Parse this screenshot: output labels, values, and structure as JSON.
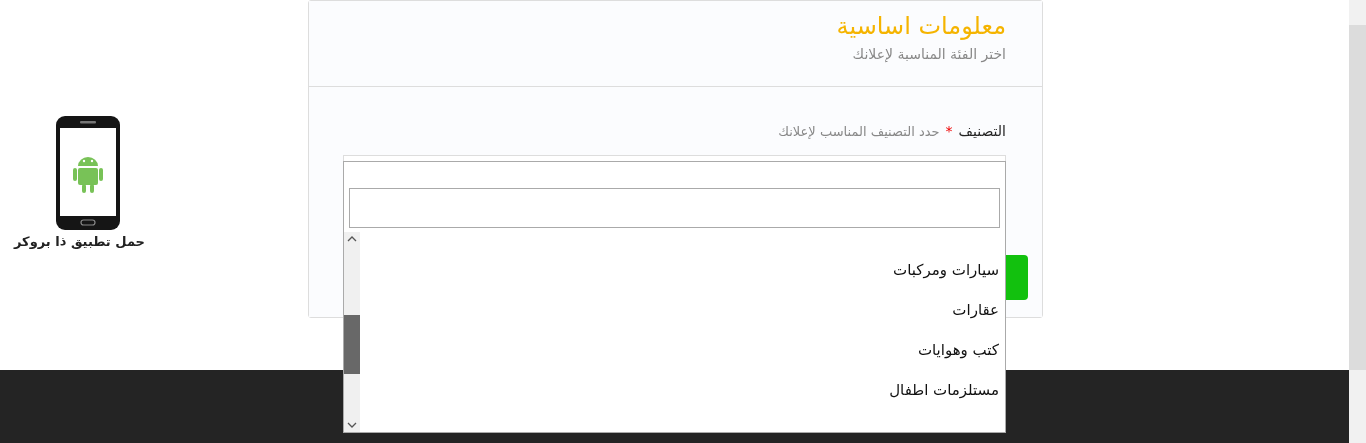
{
  "app_promo": {
    "caption": "حمل تطبيق ذا بروكر"
  },
  "card": {
    "title": "معلومات اساسية",
    "subtitle": "اختر الفئة المناسبة لإعلانك"
  },
  "category_field": {
    "label": "التصنيف",
    "required_mark": "*",
    "hint": "حدد التصنيف المناسب لإعلانك",
    "expanded": true
  },
  "dropdown": {
    "options": [
      {
        "label": "سيارات ومركبات",
        "selected": false
      },
      {
        "label": "عقارات",
        "selected": false
      },
      {
        "label": "كتب وهوايات",
        "selected": false
      },
      {
        "label": "مستلزمات اطفال",
        "selected": false
      }
    ]
  }
}
